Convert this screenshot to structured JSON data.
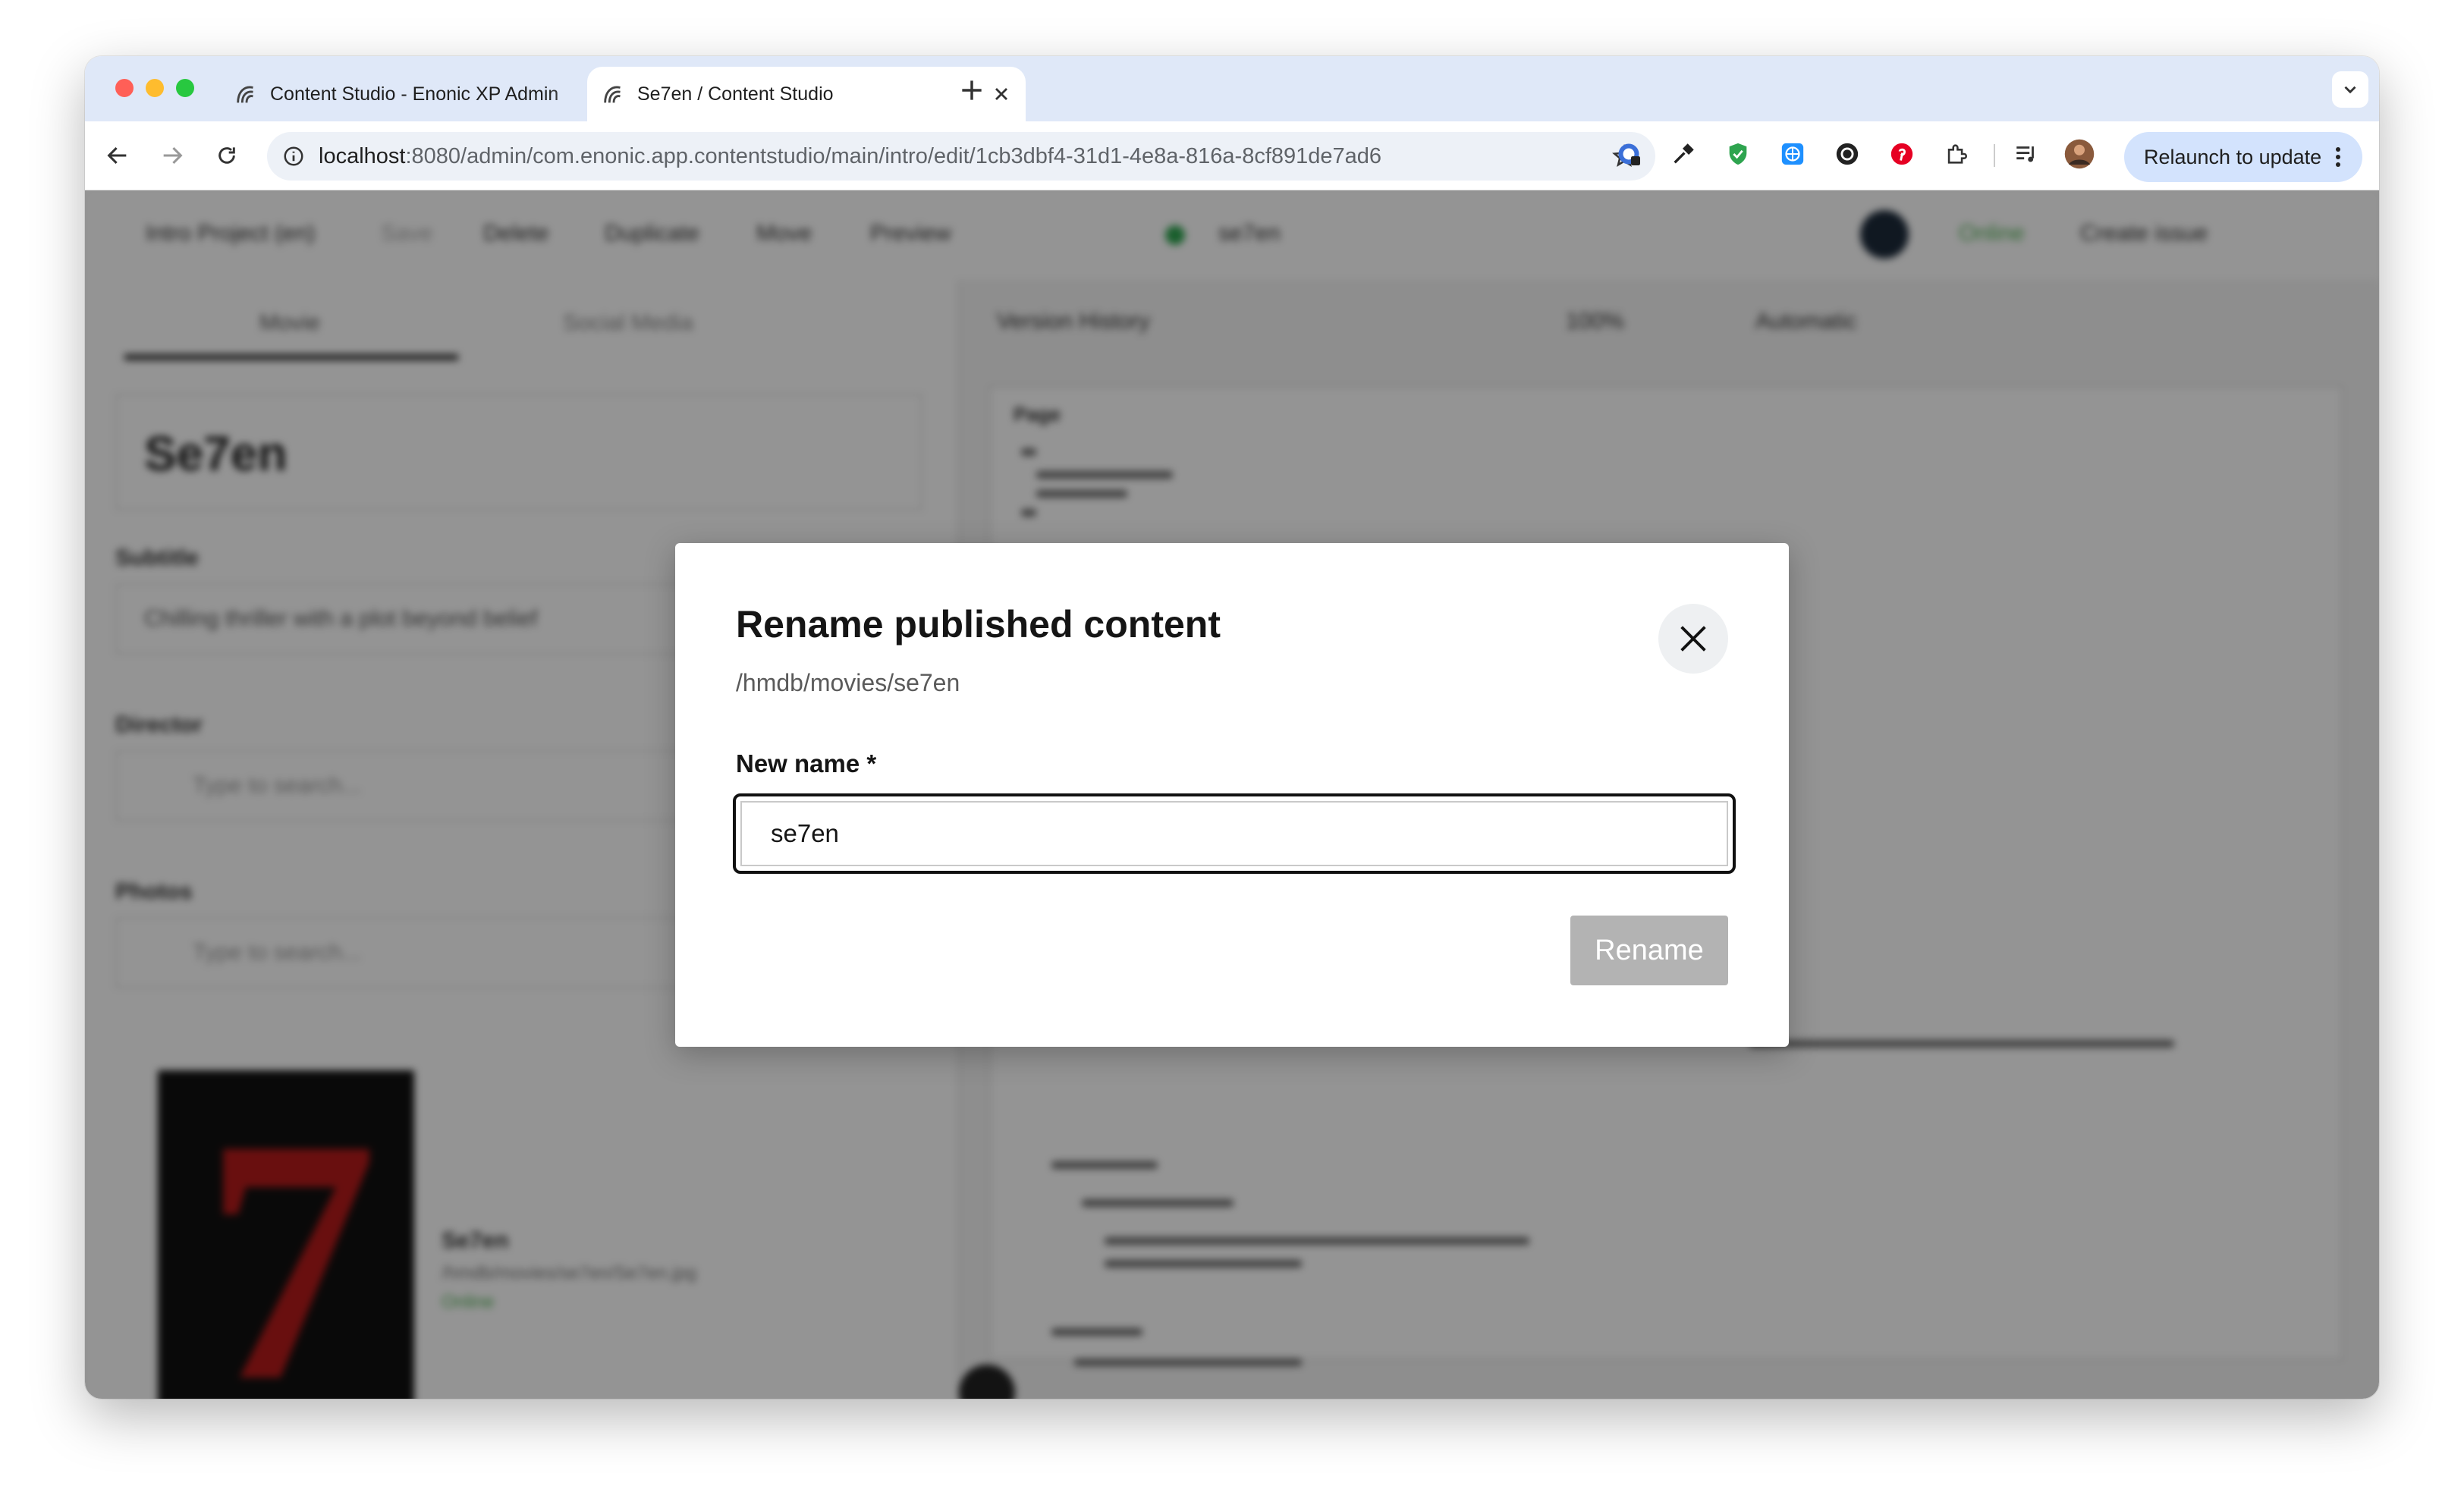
{
  "browser": {
    "tabs": [
      {
        "title": "Content Studio - Enonic XP Admin",
        "active": false
      },
      {
        "title": "Se7en / Content Studio",
        "active": true
      }
    ],
    "url_host": "localhost",
    "url_rest": ":8080/admin/com.enonic.app.contentstudio/main/intro/edit/1cb3dbf4-31d1-4e8a-816a-8cf891de7ad6",
    "relaunch_label": "Relaunch to update"
  },
  "app": {
    "project": "Intro Project (en)",
    "toolbar_actions": [
      "Save",
      "Delete",
      "Duplicate",
      "Move",
      "Preview"
    ],
    "content_name": "se7en",
    "status": "Online",
    "create_issue": "Create issue",
    "form_tabs": [
      "Movie",
      "Social Media"
    ],
    "display_name": "Se7en",
    "subtitle_label": "Subtitle",
    "subtitle_value": "Chilling thriller with a plot beyond belief",
    "director_label": "Director",
    "photos_label": "Photos",
    "search_placeholder": "Type to search...",
    "photo_title": "Se7en",
    "photo_path": "/hmdb/movies/se7en/Se7en.jpg",
    "photo_status": "Online",
    "version_history": "Version History",
    "zoom": "100%",
    "mode": "Automatic",
    "page_label": "Page"
  },
  "modal": {
    "title": "Rename published content",
    "path": "/hmdb/movies/se7en",
    "field_label": "New name *",
    "input_value": "se7en",
    "rename_label": "Rename"
  }
}
